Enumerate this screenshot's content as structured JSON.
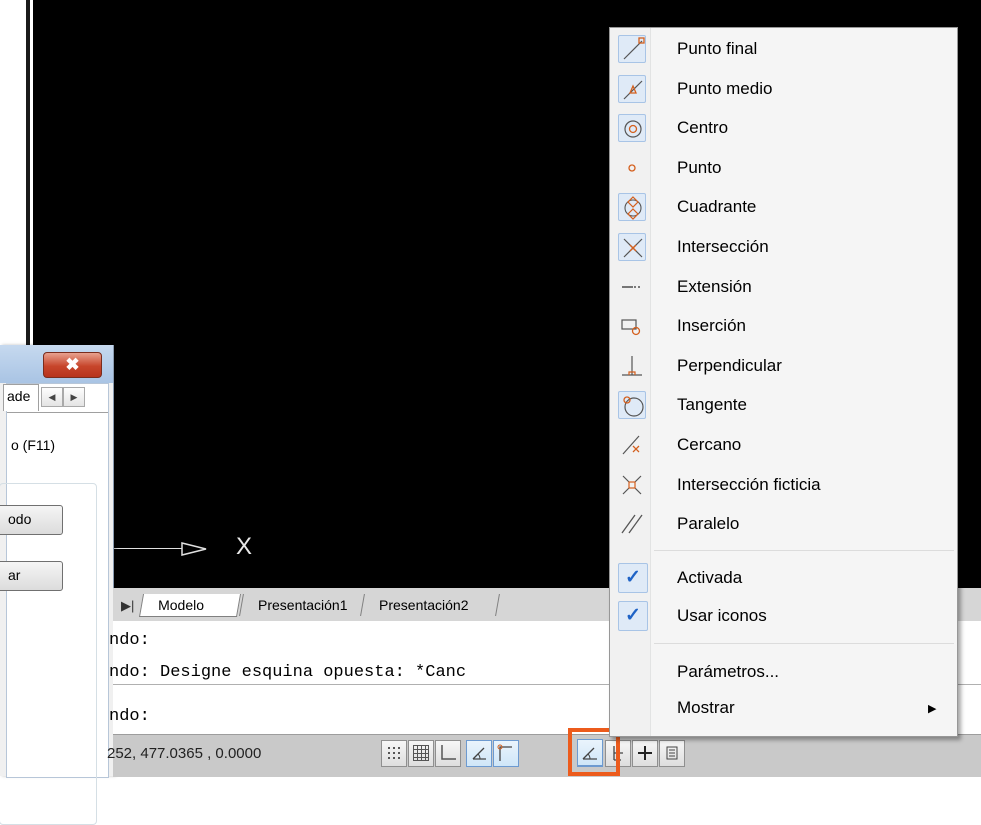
{
  "menu": {
    "snap_items": [
      {
        "label": "Punto final",
        "icon": "endpoint-snap-icon",
        "framed": true
      },
      {
        "label": "Punto medio",
        "icon": "midpoint-snap-icon",
        "framed": true
      },
      {
        "label": "Centro",
        "icon": "center-snap-icon",
        "framed": true
      },
      {
        "label": "Punto",
        "icon": "node-snap-icon",
        "framed": false
      },
      {
        "label": "Cuadrante",
        "icon": "quadrant-snap-icon",
        "framed": true
      },
      {
        "label": "Intersección",
        "icon": "intersection-snap-icon",
        "framed": true
      },
      {
        "label": "Extensión",
        "icon": "extension-snap-icon",
        "framed": false
      },
      {
        "label": "Inserción",
        "icon": "insertion-snap-icon",
        "framed": false
      },
      {
        "label": "Perpendicular",
        "icon": "perpendicular-snap-icon",
        "framed": false
      },
      {
        "label": "Tangente",
        "icon": "tangent-snap-icon",
        "framed": true
      },
      {
        "label": "Cercano",
        "icon": "nearest-snap-icon",
        "framed": false
      },
      {
        "label": "Intersección ficticia",
        "icon": "apparent-intersection-snap-icon",
        "framed": false
      },
      {
        "label": "Paralelo",
        "icon": "parallel-snap-icon",
        "framed": false
      }
    ],
    "activada": "Activada",
    "usar_iconos": "Usar iconos",
    "parametros": "Parámetros...",
    "mostrar": "Mostrar",
    "check_glyph": "✓",
    "submenu_glyph": "▶"
  },
  "dialog": {
    "close_glyph": "✖",
    "tab_fragment": "ade",
    "f11_text": "o (F11)",
    "button_1": "odo",
    "button_2": "ar"
  },
  "viewport": {
    "axis_label": "X"
  },
  "layout_tabs": {
    "nav_glyph": "▶|",
    "tabs": [
      "Modelo",
      "Presentación1",
      "Presentación2"
    ]
  },
  "command": {
    "lines": [
      "ndo:",
      "ndo: Designe esquina opuesta: *Canc",
      "ndo:"
    ]
  },
  "status": {
    "coords": "252, 477.0365 , 0.0000"
  },
  "colors": {
    "highlight": "#ec5b1c",
    "snap_accent": "#d45f1d",
    "check": "#1f63c6"
  }
}
